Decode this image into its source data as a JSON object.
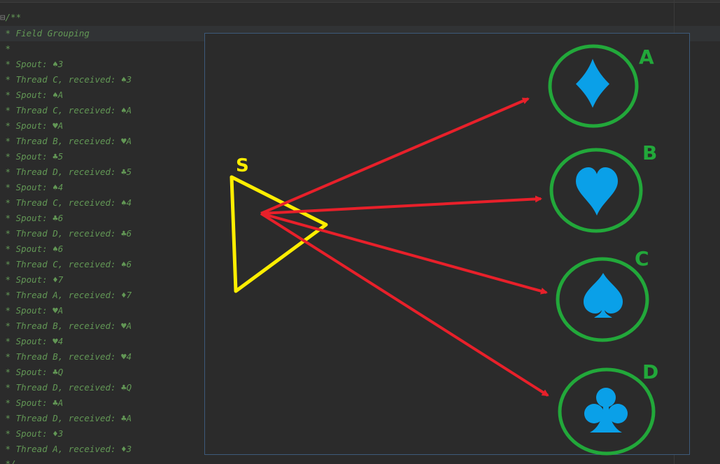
{
  "editor": {
    "comment_open": "/**",
    "comment_close": "*/",
    "lines": [
      " * Field Grouping",
      " *",
      " * Spout: ♠3",
      " * Thread C, received: ♠3",
      " * Spout: ♠A",
      " * Thread C, received: ♠A",
      " * Spout: ♥A",
      " * Thread B, received: ♥A",
      " * Spout: ♣5",
      " * Thread D, received: ♣5",
      " * Spout: ♠4",
      " * Thread C, received: ♠4",
      " * Spout: ♣6",
      " * Thread D, received: ♣6",
      " * Spout: ♠6",
      " * Thread C, received: ♠6",
      " * Spout: ♦7",
      " * Thread A, received: ♦7",
      " * Spout: ♥A",
      " * Thread B, received: ♥A",
      " * Spout: ♥4",
      " * Thread B, received: ♥4",
      " * Spout: ♣Q",
      " * Thread D, received: ♣Q",
      " * Spout: ♣A",
      " * Thread D, received: ♣A",
      " * Spout: ♦3",
      " * Thread A, received: ♦3"
    ]
  },
  "diagram": {
    "source_label": "S",
    "threads": [
      {
        "label": "A",
        "suit": "diamond-icon"
      },
      {
        "label": "B",
        "suit": "heart-icon"
      },
      {
        "label": "C",
        "suit": "spade-icon"
      },
      {
        "label": "D",
        "suit": "club-icon"
      }
    ],
    "colors": {
      "source": "#ffee00",
      "arrow": "#e8202a",
      "circle": "#22a83a",
      "label": "#22a83a",
      "suit": "#0aa0e8"
    }
  }
}
